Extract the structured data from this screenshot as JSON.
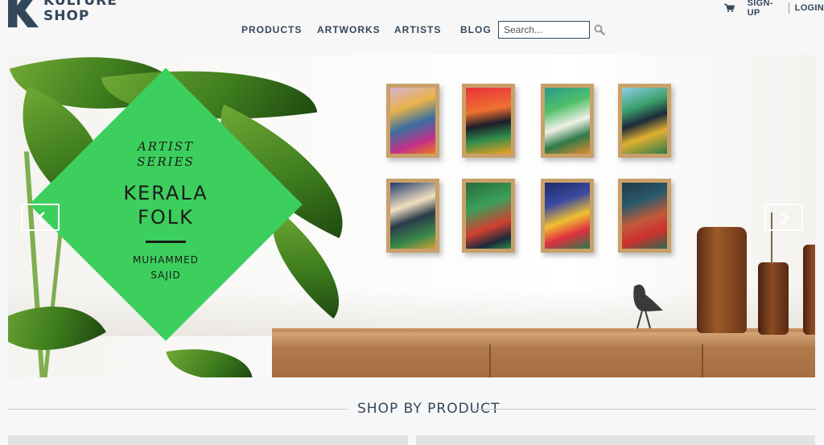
{
  "logo": {
    "line1": "KULTURE",
    "line2": "SHOP"
  },
  "nav": {
    "products": "PRODUCTS",
    "artworks": "ARTWORKS",
    "artists": "ARTISTS",
    "blog": "BLOG"
  },
  "search": {
    "placeholder": "Search..."
  },
  "account": {
    "signup": "SIGN-UP",
    "login": "LOGIN"
  },
  "hero": {
    "series_line1": "ARTIST",
    "series_line2": "SERIES",
    "title_line1": "KERALA",
    "title_line2": "FOLK",
    "artist_line1": "MUHAMMED",
    "artist_line2": "SAJID"
  },
  "section": {
    "title": "SHOP BY PRODUCT"
  },
  "colors": {
    "accent_green": "#3ccf5d",
    "brand_navy": "#33475b"
  },
  "icons": [
    "cart-icon",
    "search-icon",
    "chevron-left-icon",
    "chevron-right-icon"
  ]
}
